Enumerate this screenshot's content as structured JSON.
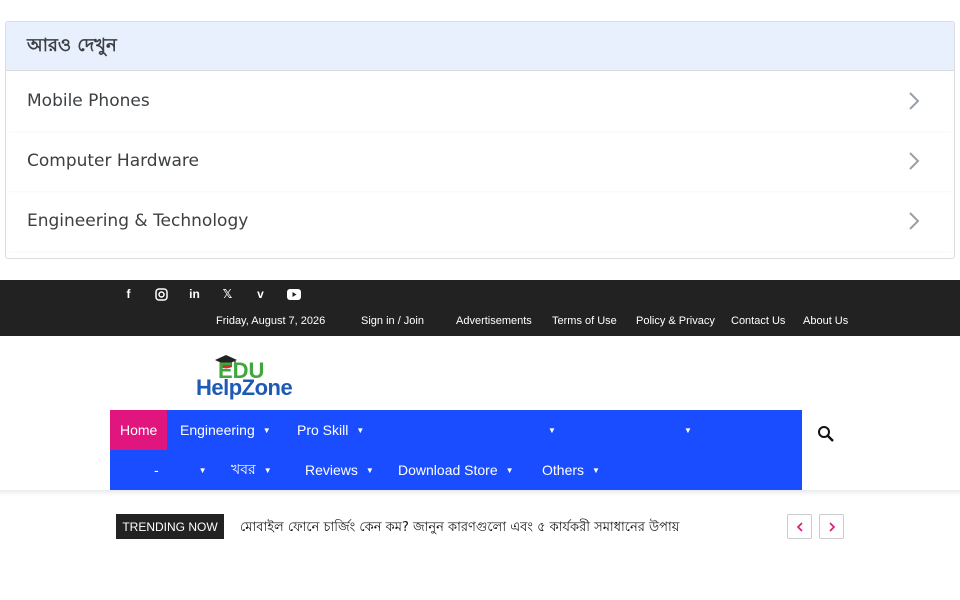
{
  "see_more": {
    "title": "আরও দেখুন",
    "items": [
      {
        "label": "Mobile Phones"
      },
      {
        "label": "Computer Hardware"
      },
      {
        "label": "Engineering & Technology"
      }
    ]
  },
  "topbar": {
    "social_icons": [
      "facebook-icon",
      "instagram-icon",
      "linkedin-icon",
      "x-icon",
      "vimeo-icon",
      "youtube-icon"
    ],
    "date": "Friday, August 7, 2026",
    "sign_in": "Sign in / Join",
    "links": [
      "Advertisements",
      "Terms of Use",
      "Policy & Privacy",
      "Contact Us",
      "About Us"
    ]
  },
  "logo": {
    "line1": "EDU",
    "line2": "HelpZone"
  },
  "menu": {
    "row1": [
      {
        "label": "Home"
      },
      {
        "label": "Engineering"
      },
      {
        "label": "Pro Skill"
      },
      {
        "label": ""
      },
      {
        "label": ""
      }
    ],
    "row2": [
      {
        "label": "-"
      },
      {
        "label": "খবর"
      },
      {
        "label": "Reviews"
      },
      {
        "label": "Download Store"
      },
      {
        "label": "Others"
      }
    ]
  },
  "trending": {
    "badge": "TRENDING NOW",
    "headline": "মোবাইল ফোনে চার্জিং কেন কম? জানুন কারণগুলো এবং ৫ কার্যকরী সমাধানের উপায়"
  },
  "colors": {
    "menu_bg": "#1a4dff",
    "home_bg": "#e0157d",
    "topbar_bg": "#222222",
    "card_head_bg": "#e8f0fe"
  }
}
